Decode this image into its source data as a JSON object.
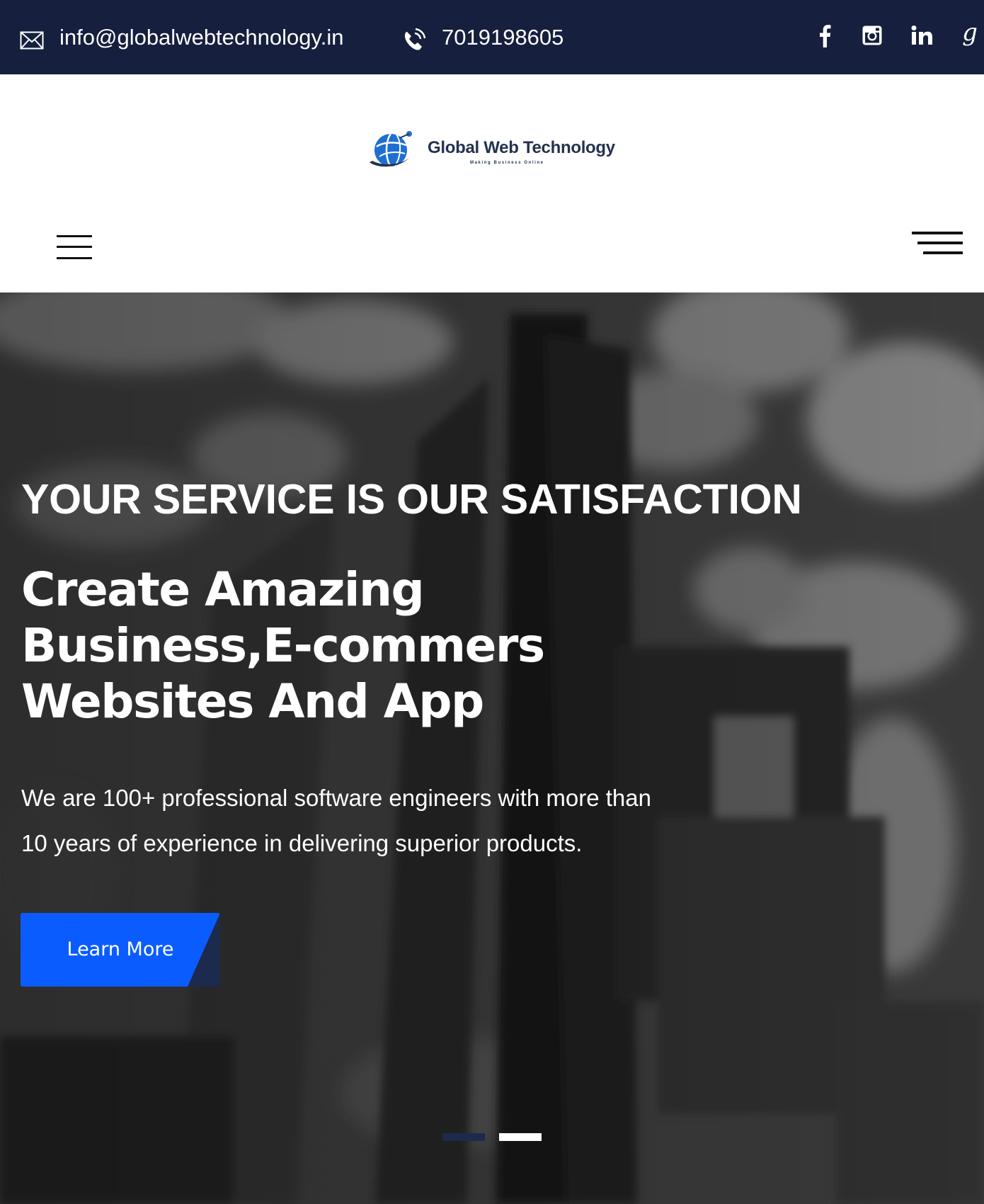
{
  "topbar": {
    "email": "info@globalwebtechnology.in",
    "phone": "7019198605",
    "email_icon": "envelope-icon",
    "phone_icon": "phone-icon",
    "social": [
      {
        "name": "facebook",
        "icon": "facebook-icon",
        "glyph": "f"
      },
      {
        "name": "instagram",
        "icon": "instagram-icon",
        "glyph": ""
      },
      {
        "name": "linkedin",
        "icon": "linkedin-icon",
        "glyph": "in"
      },
      {
        "name": "google",
        "icon": "google-icon",
        "glyph": "g"
      }
    ]
  },
  "header": {
    "logo_text": "Global Web Technology",
    "logo_tagline": "Making Business Online",
    "left_menu_icon": "hamburger-menu-icon",
    "right_menu_icon": "hamburger-menu-icon"
  },
  "hero": {
    "kicker": "YOUR SERVICE IS OUR SATISFACTION",
    "title_lines": [
      "Create Amazing",
      "Business,E-commers",
      "Websites And App"
    ],
    "description_lines": [
      "We are 100+ professional software engineers with more than",
      "10 years of experience in delivering superior products."
    ],
    "cta_label": "Learn More",
    "slides": [
      {
        "active": false
      },
      {
        "active": true
      }
    ]
  },
  "colors": {
    "topbar_bg": "#161f3d",
    "brand_dark": "#24324f",
    "accent_blue": "#0b5cff",
    "button_dark": "#1c2a4d",
    "dot_inactive": "#1c2a4d",
    "dot_active": "#ffffff"
  }
}
